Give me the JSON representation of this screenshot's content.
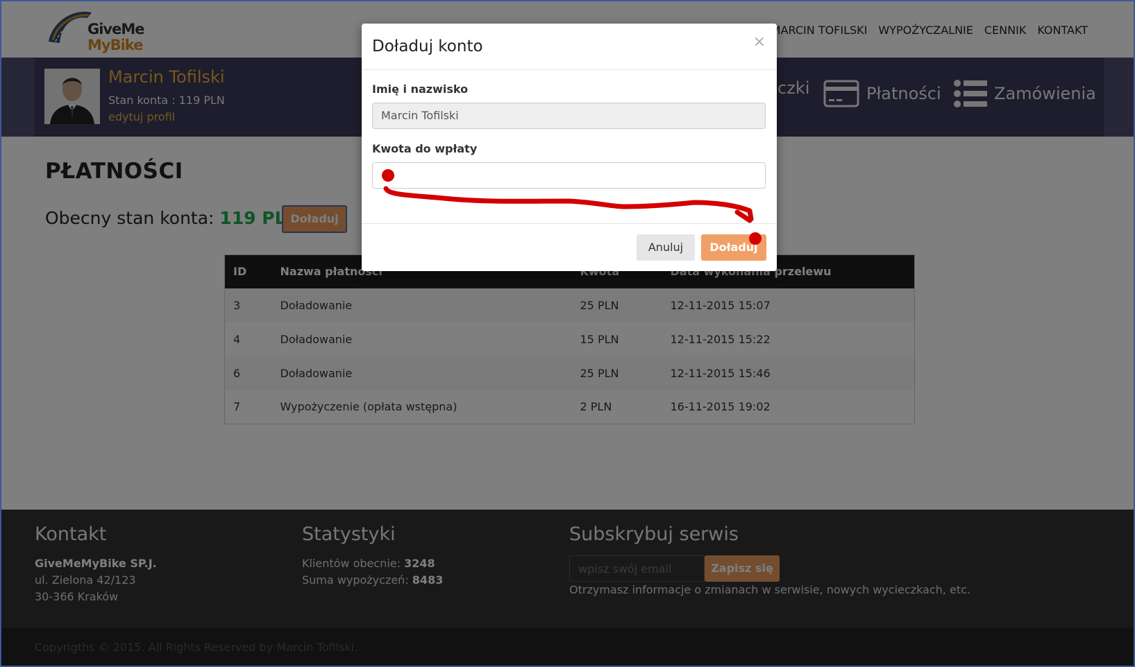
{
  "logo": {
    "line1": "GiveMe",
    "line2": "MyBike"
  },
  "nav": {
    "items": [
      "MARCIN TOFILSKI",
      "WYPOŻYCZALNIE",
      "CENNIK",
      "KONTAKT"
    ]
  },
  "profile": {
    "name": "Marcin Tofilski",
    "balance": "Stan konta : 119 PLN",
    "edit": "edytuj profil",
    "nav": [
      "czki",
      "Płatności",
      "Zamówienia"
    ]
  },
  "page": {
    "title": "PŁATNOŚCI",
    "balance_label": "Obecny stan konta: ",
    "balance_amount": "119 PLN",
    "topup_button": "Doładuj"
  },
  "table": {
    "headers": [
      "ID",
      "Nazwa płatności",
      "Kwota",
      "Data wykonania przelewu"
    ],
    "rows": [
      [
        "3",
        "Doładowanie",
        "25 PLN",
        "12-11-2015 15:07"
      ],
      [
        "4",
        "Doładowanie",
        "15 PLN",
        "12-11-2015 15:22"
      ],
      [
        "6",
        "Doładowanie",
        "25 PLN",
        "12-11-2015 15:46"
      ],
      [
        "7",
        "Wypożyczenie (opłata wstępna)",
        "2 PLN",
        "16-11-2015 19:02"
      ]
    ]
  },
  "footer": {
    "contact_title": "Kontakt",
    "company": "GiveMeMyBike SP.J.",
    "street": "ul. Zielona 42/123",
    "city": "30-366 Kraków",
    "stats_title": "Statystyki",
    "clients_label": "Klientów obecnie: ",
    "clients_value": "3248",
    "rentals_label": "Suma wypożyczeń: ",
    "rentals_value": "8483",
    "subscribe_title": "Subskrybuj serwis",
    "email_placeholder": "wpisz swój email",
    "subscribe_button": "Zapisz się",
    "subscribe_info": "Otrzymasz informacje o zmianach w serwisie, nowych wycieczkach, etc.",
    "copyright": "Copyrigths © 2015. All Rights Reserved by Marcin Tofilski."
  },
  "modal": {
    "title": "Doładuj konto",
    "close": "×",
    "name_label": "Imię i nazwisko",
    "name_value": "Marcin Tofilski",
    "amount_label": "Kwota do wpłaty",
    "amount_value": "",
    "cancel_button": "Anuluj",
    "submit_button": "Doładuj"
  },
  "colors": {
    "accent": "#e89a5e",
    "profile_bar": "#3c3a5a",
    "balance_green": "#1fa84d",
    "annotation_red": "#d40000"
  }
}
